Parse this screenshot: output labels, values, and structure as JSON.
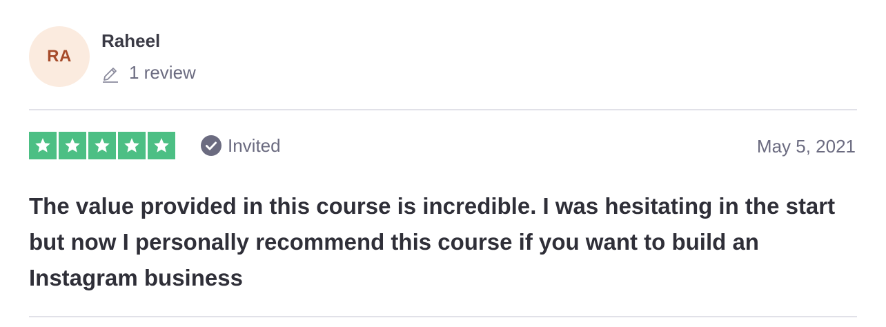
{
  "reviewer": {
    "initials": "RA",
    "name": "Raheel",
    "review_count": "1 review",
    "avatar_bg": "#fbebdf",
    "avatar_fg": "#a64b2a"
  },
  "rating": {
    "stars": 5,
    "max_stars": 5,
    "star_color": "#4cbf84"
  },
  "badge": {
    "label": "Invited",
    "icon": "check-circle-icon"
  },
  "date": "May 5, 2021",
  "review_text": "The value provided in this course is incredible. I was hesitating in the start but now I personally recommend this course if you want to build an Instagram business"
}
